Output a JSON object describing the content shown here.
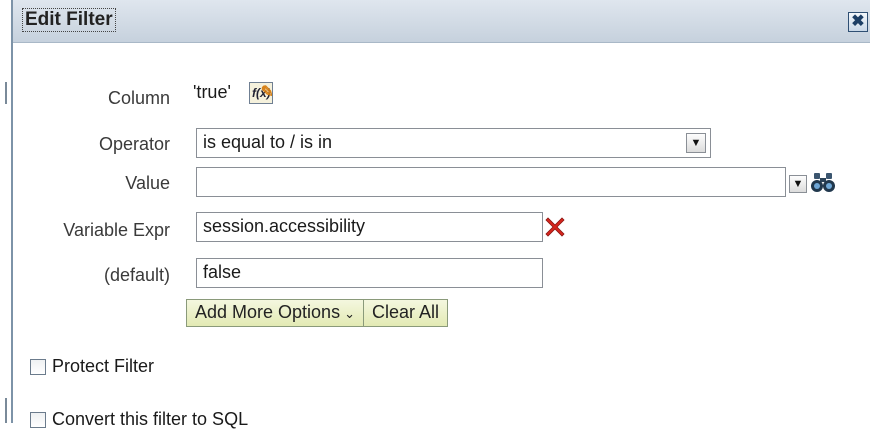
{
  "dialog": {
    "title": "Edit Filter",
    "close_glyph": "✖"
  },
  "form": {
    "column": {
      "label": "Column",
      "value": "'true'",
      "edit_icon_text": "f(x)"
    },
    "operator": {
      "label": "Operator",
      "selected": "is equal to / is in"
    },
    "value": {
      "label": "Value",
      "input_value": ""
    },
    "variable_expr": {
      "label": "Variable Expr",
      "input_value": "session.accessibility"
    },
    "default": {
      "label": "(default)",
      "input_value": "false"
    }
  },
  "buttons": {
    "add_more_options": "Add More Options",
    "add_more_chevron": "⌄",
    "clear_all": "Clear All"
  },
  "checkboxes": {
    "protect_filter": {
      "label": "Protect Filter",
      "checked": false
    },
    "convert_sql": {
      "label": "Convert this filter to SQL",
      "checked": false
    }
  },
  "icons": {
    "edit_column": "edit-formula-icon",
    "dropdown": "chevron-down-icon",
    "search_values": "binoculars-icon",
    "delete": "delete-x-icon",
    "close": "close-icon"
  },
  "colors": {
    "titlebar": "#c6d1dd",
    "button_fill": "#e3eab4",
    "delete_red": "#d7261e"
  }
}
